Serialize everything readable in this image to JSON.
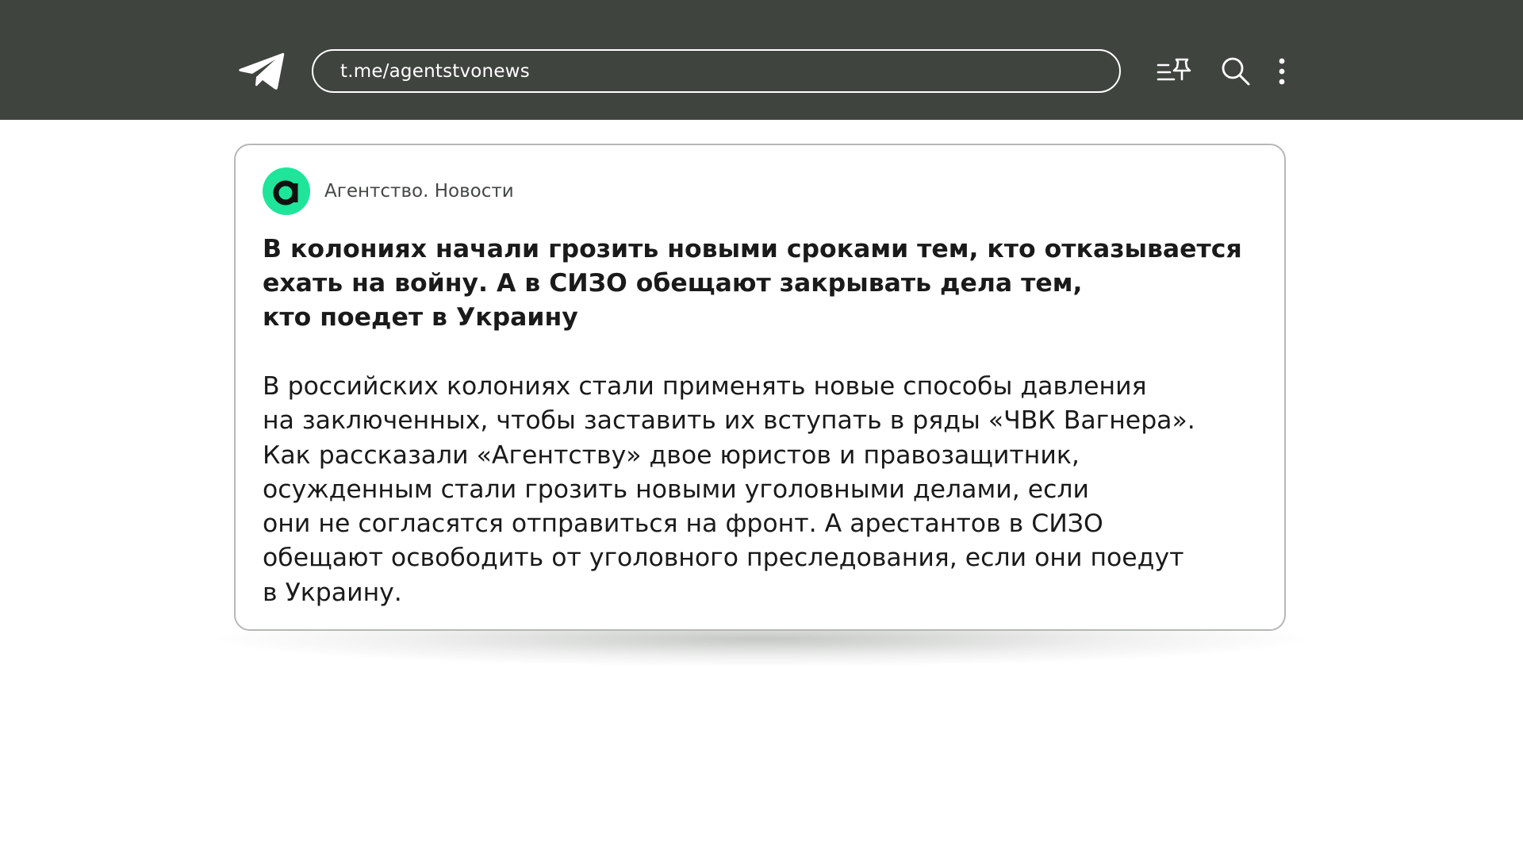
{
  "topbar": {
    "url": "t.me/agentstvonews",
    "icons": [
      "telegram-icon",
      "pinned-list-icon",
      "search-icon",
      "more-vert-icon"
    ],
    "background_color": "#3f443e"
  },
  "post": {
    "channel_name": "Агентство. Новости",
    "avatar_letter": "a",
    "avatar_color": "#1ee59a",
    "headline_lines": [
      "В колониях начали грозить новыми сроками тем, кто отказывается",
      "ехать на войну. А в СИЗО обещают закрывать дела тем,",
      "кто поедет в Украину"
    ],
    "body_lines": [
      "В российских колониях стали применять новые способы давления",
      "на заключенных, чтобы заставить их вступать в ряды «ЧВК Вагнера».",
      "Как рассказали «Агентству» двое юристов и правозащитник,",
      "осужденным стали грозить новыми уголовными делами, если",
      "они не согласятся отправиться на фронт. А арестантов в СИЗО",
      "обещают освободить от уголовного преследования, если они поедут",
      "в Украину."
    ]
  }
}
